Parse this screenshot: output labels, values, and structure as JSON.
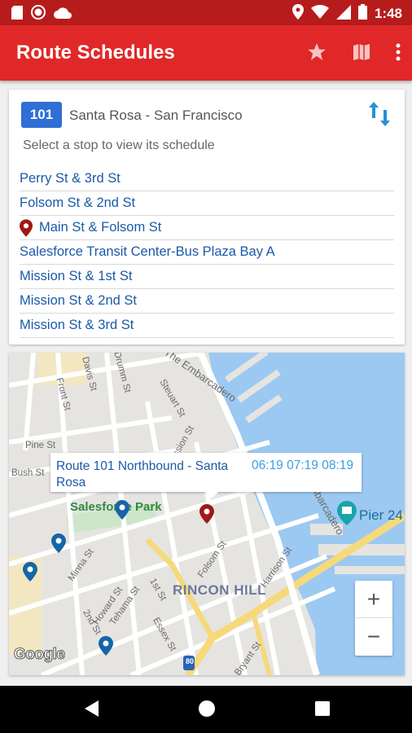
{
  "status_bar": {
    "time": "1:48",
    "left_icons": [
      "sd-card-icon",
      "record-icon",
      "cloud-icon"
    ],
    "right_icons": [
      "location-icon",
      "wifi-icon",
      "signal-icon",
      "battery-icon"
    ]
  },
  "app_bar": {
    "title": "Route Schedules",
    "actions": [
      "star-icon",
      "map-icon",
      "more-vert-icon"
    ]
  },
  "route": {
    "number": "101",
    "name": "Santa Rosa - San Francisco",
    "hint": "Select a stop to view its schedule",
    "stops": [
      {
        "label": "Perry St & 3rd St",
        "selected": false
      },
      {
        "label": "Folsom St & 2nd St",
        "selected": false
      },
      {
        "label": "Main St & Folsom St",
        "selected": true
      },
      {
        "label": "Salesforce Transit Center-Bus Plaza Bay A",
        "selected": false
      },
      {
        "label": "Mission St & 1st St",
        "selected": false
      },
      {
        "label": "Mission St & 2nd St",
        "selected": false
      },
      {
        "label": "Mission St & 3rd St",
        "selected": false
      }
    ]
  },
  "map": {
    "info_window": {
      "route": "Route 101 Northbound - Santa Rosa",
      "times": "06:19 07:19 08:19"
    },
    "labels": {
      "park": "Salesforce Park",
      "district": "RINCON HILL",
      "pier": "Pier 24",
      "embarcadero": "The Embarcadero",
      "embarcadero2": "The Embarcadero",
      "davis": "Davis St",
      "drumm": "Drumm St",
      "front": "Front St",
      "steuart": "Steuart St",
      "pine": "Pine St",
      "bush": "Bush St",
      "mission": "Mission St",
      "folsom": "Folsom St",
      "harrison": "Harrison St",
      "minna": "Minna St",
      "howard": "Howard St",
      "tehama": "Tehama St",
      "first": "1st St",
      "second": "2nd St",
      "essex": "Essex St",
      "bryant": "Bryant St",
      "interstate": "80"
    },
    "attribution": "Google",
    "zoom_in": "+",
    "zoom_out": "−"
  },
  "colors": {
    "status_bar": "#b71c1c",
    "app_bar": "#e02828",
    "route_badge": "#2f6fd6",
    "stop_text": "#1b5aa8",
    "pin_red": "#a01818",
    "pin_blue": "#1565a8",
    "water": "#9cc9f1"
  },
  "nav_bar": {
    "buttons": [
      "back-icon",
      "home-icon",
      "recents-icon"
    ]
  }
}
